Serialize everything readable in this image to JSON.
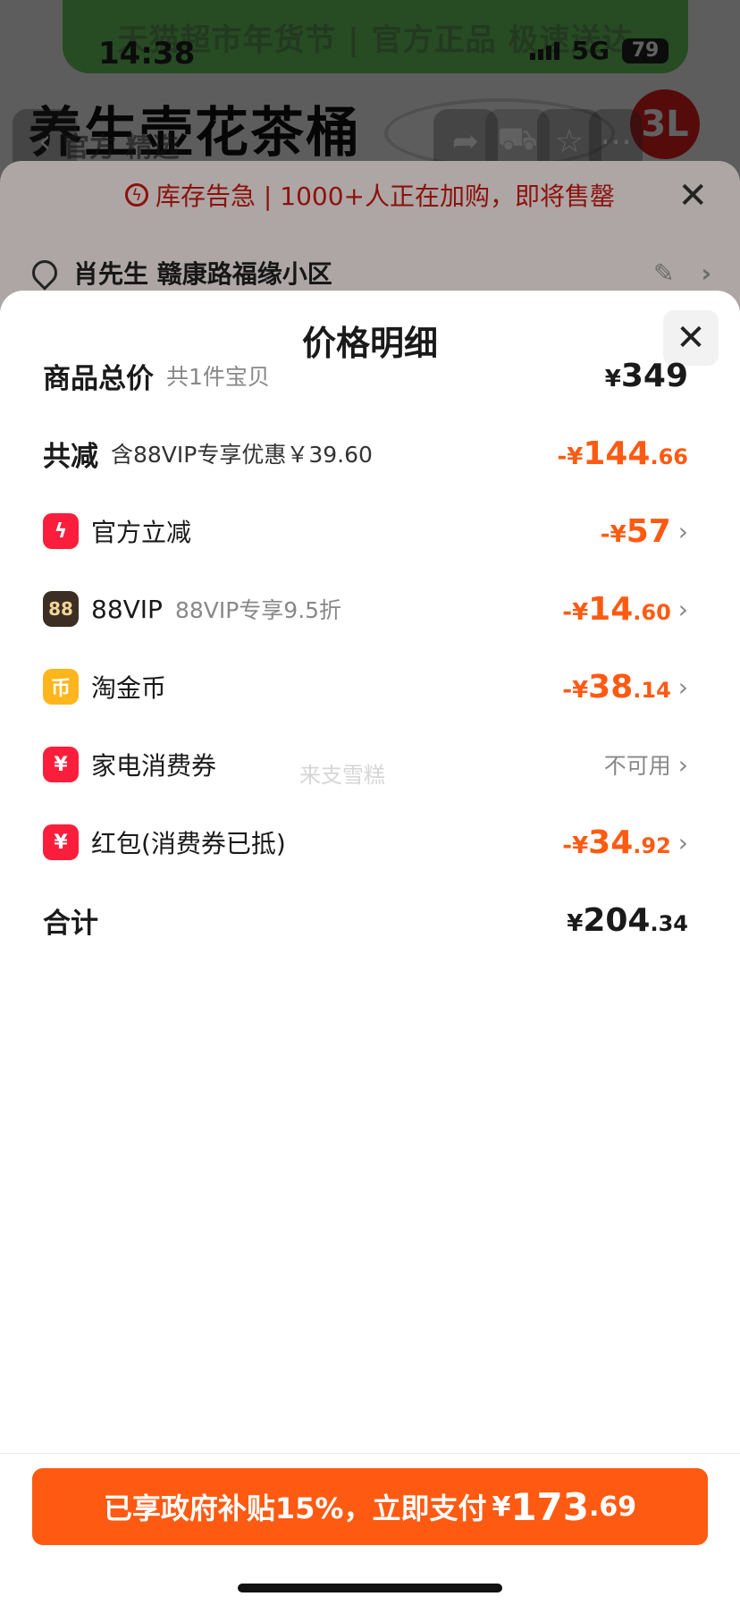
{
  "status_bar": {
    "time": "14:38",
    "network": "5G",
    "battery": "79"
  },
  "background": {
    "banner": "天猫超市年货节 | 官方正品 极速送达",
    "headline": "养生壶花茶桶",
    "search_hint": "官方 精选",
    "badge": "3L",
    "notice": "库存告急 | 1000+人正在加购，即将售罄",
    "address": "肖先生 赣康路福缘小区"
  },
  "modal": {
    "title": "价格明细",
    "watermark": "来支雪糕",
    "rows": [
      {
        "label": "商品总价",
        "sub": "共1件宝贝",
        "currency": "¥",
        "int": "349",
        "dec": ""
      },
      {
        "label": "共减",
        "sub": "含88VIP专享优惠￥39.60",
        "prefix": "-¥",
        "int": "144",
        "dec": ".66"
      },
      {
        "label": "官方立减",
        "prefix": "-¥",
        "int": "57",
        "dec": ""
      },
      {
        "label": "88VIP",
        "icon_text": "88",
        "sub": "88VIP专享9.5折",
        "prefix": "-¥",
        "int": "14",
        "dec": ".60"
      },
      {
        "label": "淘金币",
        "icon_text": "币",
        "prefix": "-¥",
        "int": "38",
        "dec": ".14"
      },
      {
        "label": "家电消费券",
        "icon_text": "¥",
        "value": "不可用"
      },
      {
        "label": "红包(消费券已抵)",
        "icon_text": "¥",
        "prefix": "-¥",
        "int": "34",
        "dec": ".92"
      },
      {
        "label": "合计",
        "currency": "¥",
        "int": "204",
        "dec": ".34"
      }
    ]
  },
  "pay_button": {
    "label": "已享政府补贴15%，立即支付",
    "currency": "¥",
    "int": "173",
    "dec": ".69"
  },
  "colors": {
    "accent": "#ff5a12",
    "icon_red": "#fa1e3c",
    "icon_vip": "#3c2e22",
    "icon_coin": "#ffb61c"
  }
}
